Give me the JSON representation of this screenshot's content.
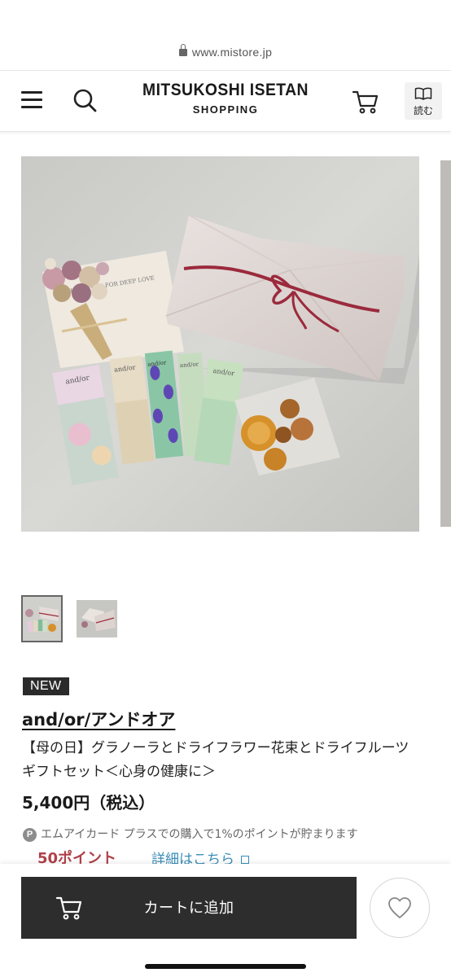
{
  "browser": {
    "url": "www.mistore.jp"
  },
  "header": {
    "brand_main": "MITSUKOSHI ISETAN",
    "brand_sub": "SHOPPING",
    "read_label": "読む"
  },
  "product": {
    "badge": "NEW",
    "brand": "and/or/アンドオア",
    "name": "【母の日】グラノーラとドライフラワー花束とドライフルーツ　ギフトセット＜心身の健康に＞",
    "price": "5,400円（税込）",
    "points_note": "エムアイカード プラスでの購入で1%のポイントが貯まります",
    "points_icon": "P",
    "points_value": "50ポイント",
    "details_link": "詳細はこちら"
  },
  "image_card": {
    "text": "THANK YOU FOR DEEP LOVE"
  },
  "packets": [
    "and/or",
    "and/or",
    "and/or",
    "and/or",
    "and/or"
  ],
  "actions": {
    "add_to_cart": "カートに追加"
  },
  "colors": {
    "badge_bg": "#2b2b2b",
    "cart_bg": "#2d2d2d",
    "points": "#b0414a",
    "link": "#3a8db8"
  }
}
